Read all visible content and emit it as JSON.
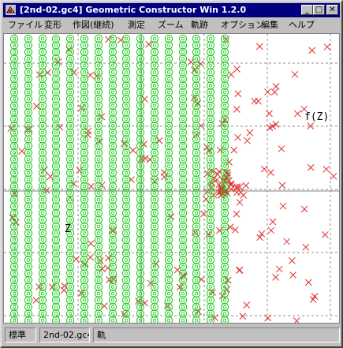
{
  "window": {
    "title": "[2nd-02.gc4] Geometric Constructor Win 1.2.0",
    "min_glyph": "_",
    "max_glyph": "□",
    "close_glyph": "✕"
  },
  "menu": [
    {
      "label": "ファイル"
    },
    {
      "label": "変形"
    },
    {
      "label": "作図(継続)"
    },
    {
      "label": "測定"
    },
    {
      "label": "ズーム"
    },
    {
      "label": "軌跡"
    },
    {
      "label": "オプション"
    },
    {
      "label": "編集"
    },
    {
      "label": "ヘルプ"
    }
  ],
  "canvas": {
    "label_fz": "f(Z)",
    "label_z": "Z",
    "colors": {
      "circle": "#22cc22",
      "cross": "#e03030",
      "grid": "#909090",
      "axis": "#808080"
    }
  },
  "status": {
    "mode": "標準",
    "file": "2nd-02.gc4",
    "extra": "軌"
  }
}
